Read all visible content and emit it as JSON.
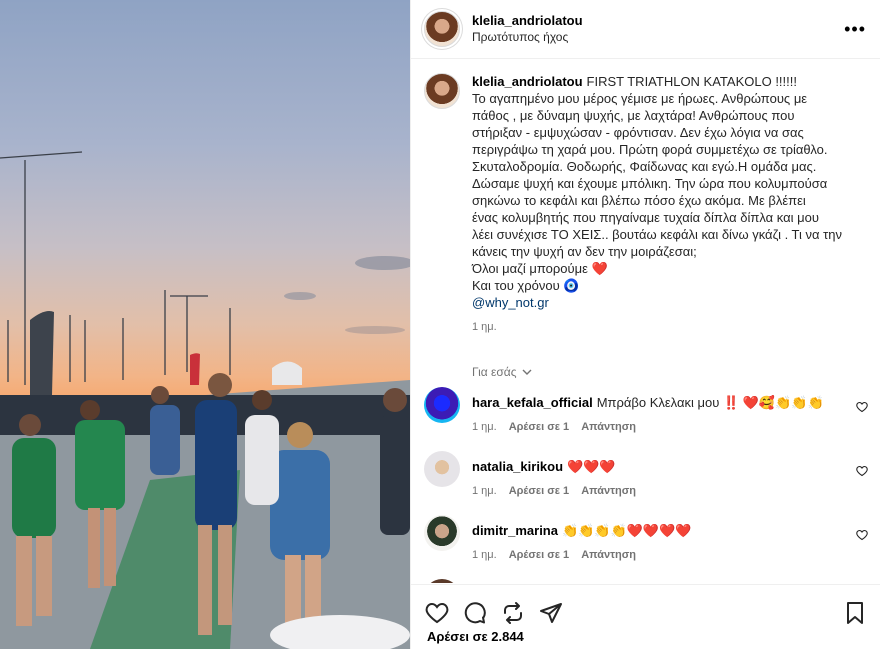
{
  "post": {
    "username": "klelia_andriolatou",
    "audio": "Πρωτότυπος ήχος",
    "caption_title": "FIRST TRIATHLON KATAKOLO !!!!!!",
    "caption_lines": [
      "Το αγαπημένο μου μέρος γέμισε με ήρωες. Ανθρώπους με",
      "πάθος , με δύναμη ψυχής, με λαχτάρα! Ανθρώπους που",
      "στήριξαν - εμψυχώσαν - φρόντισαν. Δεν έχω λόγια να σας",
      "περιγράψω τη χαρά μου. Πρώτη φορά συμμετέχω σε τρίαθλο.",
      "Σκυταλοδρομία. Θοδωρής, Φαίδωνας και εγώ.Η ομάδα μας.",
      "Δώσαμε ψυχή και έχουμε μπόλικη. Την ώρα που κολυμπούσα",
      "σηκώνω το κεφάλι και βλέπω πόσο έχω ακόμα. Με βλέπει",
      "ένας κολυμβητής που πηγαίναμε τυχαία δίπλα δίπλα και μου",
      "λέει συνέχισε ΤΟ ΧΕΙΣ.. βουτάω κεφάλι και δίνω γκάζι . Τι να την",
      "κάνεις την ψυχή αν δεν την μοιράζεσαι;",
      "Όλοι μαζί μπορούμε ❤️",
      "Και του χρόνου 🧿"
    ],
    "mention": "@why_not.gr",
    "time": "1 ημ.",
    "likes": "Αρέσει σε 2.844"
  },
  "for_you": "Για εσάς",
  "comments": [
    {
      "username": "hara_kefala_official",
      "text": "Μπράβο Κλελακι μου ‼️ ❤️🥰👏👏👏",
      "time": "1 ημ.",
      "likes": "Αρέσει σε 1",
      "reply": "Απάντηση"
    },
    {
      "username": "natalia_kirikou",
      "text": "❤️❤️❤️",
      "time": "1 ημ.",
      "likes": "Αρέσει σε 1",
      "reply": "Απάντηση"
    },
    {
      "username": "dimitr_marina",
      "text": "👏👏👏👏❤️❤️❤️❤️",
      "time": "1 ημ.",
      "likes": "Αρέσει σε 1",
      "reply": "Απάντηση"
    }
  ],
  "partial_comment_text": "❤️❤️❤️❤️",
  "colors": {
    "link": "#00376b",
    "muted": "#737373",
    "border": "#efefef"
  }
}
